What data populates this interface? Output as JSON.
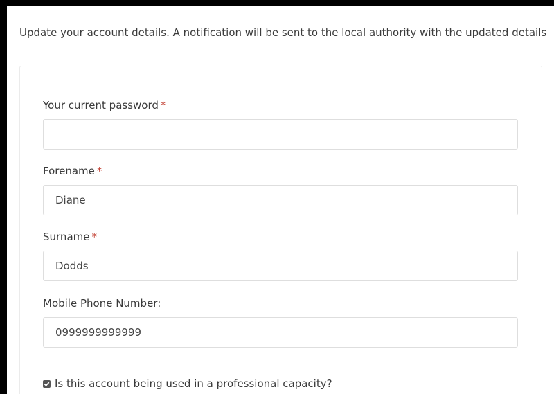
{
  "intro_text": "Update your account details. A notification will be sent to the local authority with the updated details",
  "form": {
    "required_marker": "*",
    "current_password": {
      "label": "Your current password",
      "value": ""
    },
    "forename": {
      "label": "Forename",
      "value": "Diane"
    },
    "surname": {
      "label": "Surname",
      "value": "Dodds"
    },
    "mobile": {
      "label": "Mobile Phone Number:",
      "value": "0999999999999"
    },
    "professional": {
      "label": "Is this account being used in a professional capacity?",
      "checked": true
    }
  },
  "colors": {
    "required": "#c0392b",
    "border": "#dedede"
  }
}
